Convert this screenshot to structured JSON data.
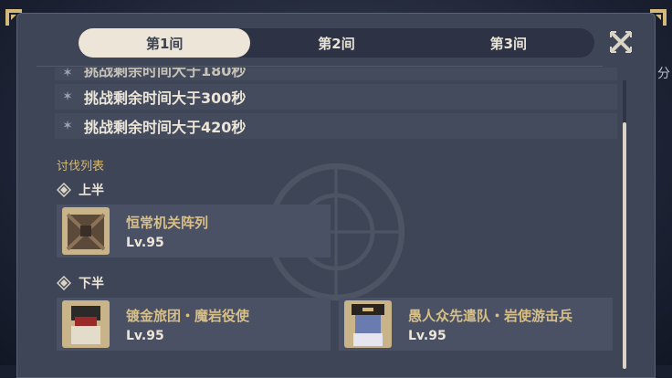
{
  "tabs": [
    "第1间",
    "第2间",
    "第3间"
  ],
  "challenges": [
    "挑战剩余时间大于180秒",
    "挑战剩余时间大于300秒",
    "挑战剩余时间大于420秒"
  ],
  "right_hint": "分",
  "enemy_list": {
    "title": "讨伐列表",
    "first_half": {
      "label": "上半",
      "enemies": [
        {
          "name": "恒常机关阵列",
          "level": "Lv.95"
        }
      ]
    },
    "second_half": {
      "label": "下半",
      "enemies": [
        {
          "name": "镀金旅团・魔岩役使",
          "level": "Lv.95"
        },
        {
          "name": "愚人众先遣队・岩使游击兵",
          "level": "Lv.95"
        }
      ]
    }
  },
  "colors": {
    "panel": "#3e4557",
    "tab_active": "#ece5d8",
    "enemy_name": "#d8bf86",
    "section_label": "#d4b97a"
  },
  "icons": [
    "star-icon",
    "diamond-icon",
    "close-icon",
    "corner-ornament-icon"
  ]
}
